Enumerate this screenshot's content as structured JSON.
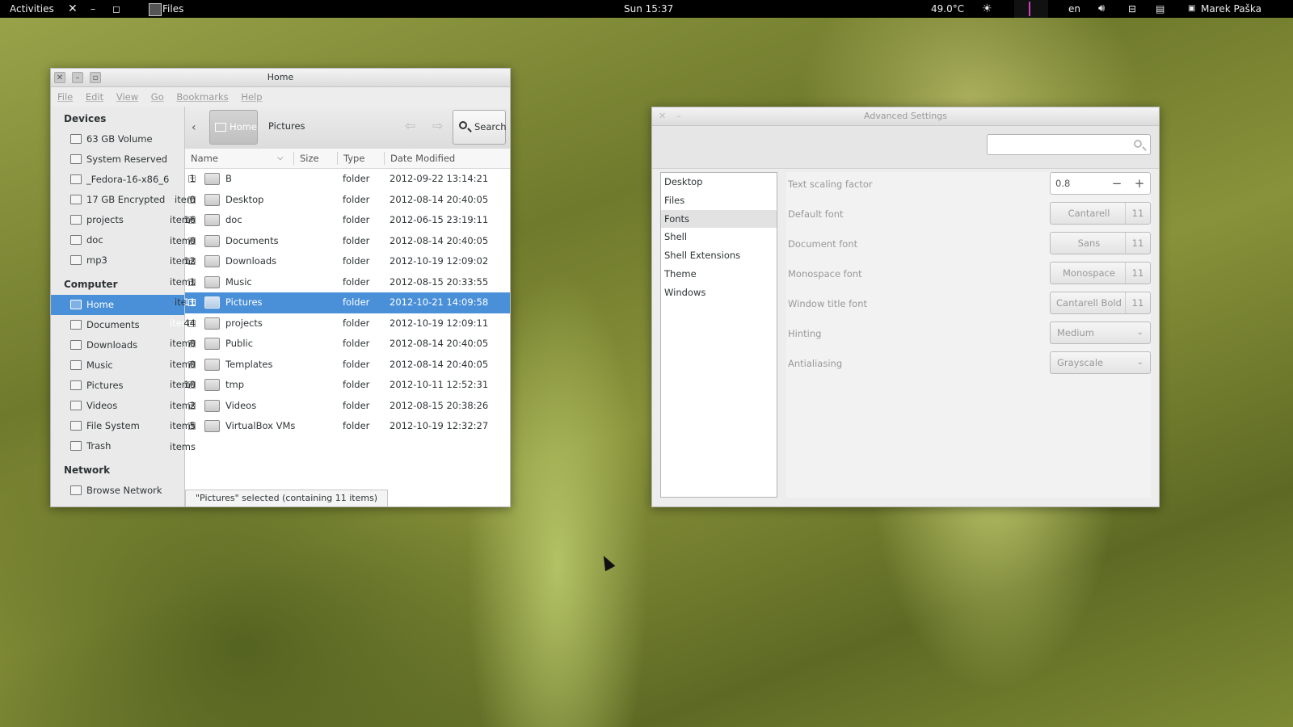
{
  "topbar": {
    "activities": "Activities",
    "app_name": "Files",
    "clock": "Sun 15:37",
    "temperature": "49.0°C",
    "language": "en",
    "user": "Marek Paška"
  },
  "files": {
    "title": "Home",
    "menu": [
      "File",
      "Edit",
      "View",
      "Go",
      "Bookmarks",
      "Help"
    ],
    "sidebar": {
      "devices_header": "Devices",
      "devices": [
        "63 GB Volume",
        "System Reserved",
        "_Fedora-16-x86_6",
        "17 GB Encrypted",
        "projects",
        "doc",
        "mp3"
      ],
      "computer_header": "Computer",
      "computer": [
        "Home",
        "Documents",
        "Downloads",
        "Music",
        "Pictures",
        "Videos",
        "File System",
        "Trash"
      ],
      "network_header": "Network",
      "network": [
        "Browse Network"
      ]
    },
    "toolbar": {
      "crumb_home": "Home",
      "crumb_current": "Pictures",
      "search": "Search"
    },
    "columns": {
      "name": "Name",
      "size": "Size",
      "type": "Type",
      "date": "Date Modified"
    },
    "rows": [
      {
        "name": "B",
        "size": "1 item",
        "type": "folder",
        "date": "2012-09-22 13:14:21"
      },
      {
        "name": "Desktop",
        "size": "0 items",
        "type": "folder",
        "date": "2012-08-14 20:40:05"
      },
      {
        "name": "doc",
        "size": "16 items",
        "type": "folder",
        "date": "2012-06-15 23:19:11"
      },
      {
        "name": "Documents",
        "size": "0 items",
        "type": "folder",
        "date": "2012-08-14 20:40:05"
      },
      {
        "name": "Downloads",
        "size": "12 items",
        "type": "folder",
        "date": "2012-10-19 12:09:02"
      },
      {
        "name": "Music",
        "size": "1 item",
        "type": "folder",
        "date": "2012-08-15 20:33:55"
      },
      {
        "name": "Pictures",
        "size": "11 items",
        "type": "folder",
        "date": "2012-10-21 14:09:58"
      },
      {
        "name": "projects",
        "size": "44 items",
        "type": "folder",
        "date": "2012-10-19 12:09:11"
      },
      {
        "name": "Public",
        "size": "0 items",
        "type": "folder",
        "date": "2012-08-14 20:40:05"
      },
      {
        "name": "Templates",
        "size": "0 items",
        "type": "folder",
        "date": "2012-08-14 20:40:05"
      },
      {
        "name": "tmp",
        "size": "10 items",
        "type": "folder",
        "date": "2012-10-11 12:52:31"
      },
      {
        "name": "Videos",
        "size": "2 items",
        "type": "folder",
        "date": "2012-08-15 20:38:26"
      },
      {
        "name": "VirtualBox VMs",
        "size": "5 items",
        "type": "folder",
        "date": "2012-10-19 12:32:27"
      }
    ],
    "status": "\"Pictures\" selected (containing 11 items)"
  },
  "advanced": {
    "title": "Advanced Settings",
    "categories": [
      "Desktop",
      "Files",
      "Fonts",
      "Shell",
      "Shell Extensions",
      "Theme",
      "Windows"
    ],
    "settings": {
      "scaling_label": "Text scaling factor",
      "scaling_value": "0.8",
      "minus": "−",
      "plus": "+",
      "default_font_label": "Default font",
      "default_font_name": "Cantarell",
      "default_font_size": "11",
      "document_font_label": "Document font",
      "document_font_name": "Sans",
      "document_font_size": "11",
      "mono_font_label": "Monospace font",
      "mono_font_name": "Monospace",
      "mono_font_size": "11",
      "title_font_label": "Window title font",
      "title_font_name": "Cantarell Bold",
      "title_font_size": "11",
      "hinting_label": "Hinting",
      "hinting_value": "Medium",
      "antialiasing_label": "Antialiasing",
      "antialiasing_value": "Grayscale"
    }
  }
}
